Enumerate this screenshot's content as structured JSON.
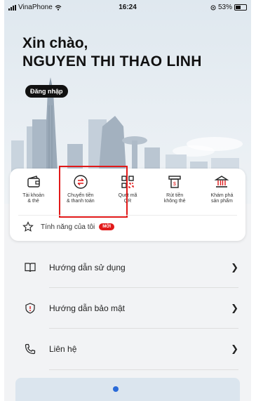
{
  "status_bar": {
    "carrier": "VinaPhone",
    "time": "16:24",
    "battery": "53%"
  },
  "greeting": {
    "line1": "Xin chào,",
    "line2": "NGUYEN THI THAO LINH"
  },
  "login_label": "Đăng nhập",
  "quick_actions": [
    {
      "icon": "wallet-icon",
      "line1": "Tài khoản",
      "line2": "& thẻ"
    },
    {
      "icon": "transfer-icon",
      "line1": "Chuyển tiền",
      "line2": "& thanh toán"
    },
    {
      "icon": "qr-icon",
      "line1": "Quét mã",
      "line2": "QR"
    },
    {
      "icon": "atm-icon",
      "line1": "Rút tiền",
      "line2": "không thẻ"
    },
    {
      "icon": "bank-icon",
      "line1": "Khám phá",
      "line2": "sản phẩm"
    }
  ],
  "favorites": {
    "label": "Tính năng của tôi",
    "badge": "MỚI"
  },
  "menu": [
    {
      "icon": "book-icon",
      "label": "Hướng dẫn sử dụng"
    },
    {
      "icon": "shield-icon",
      "label": "Hướng dẫn bảo mật"
    },
    {
      "icon": "phone-icon",
      "label": "Liên hệ"
    }
  ],
  "colors": {
    "accent": "#e11919",
    "text": "#222222",
    "hero_bg": "#e3ebf1"
  }
}
